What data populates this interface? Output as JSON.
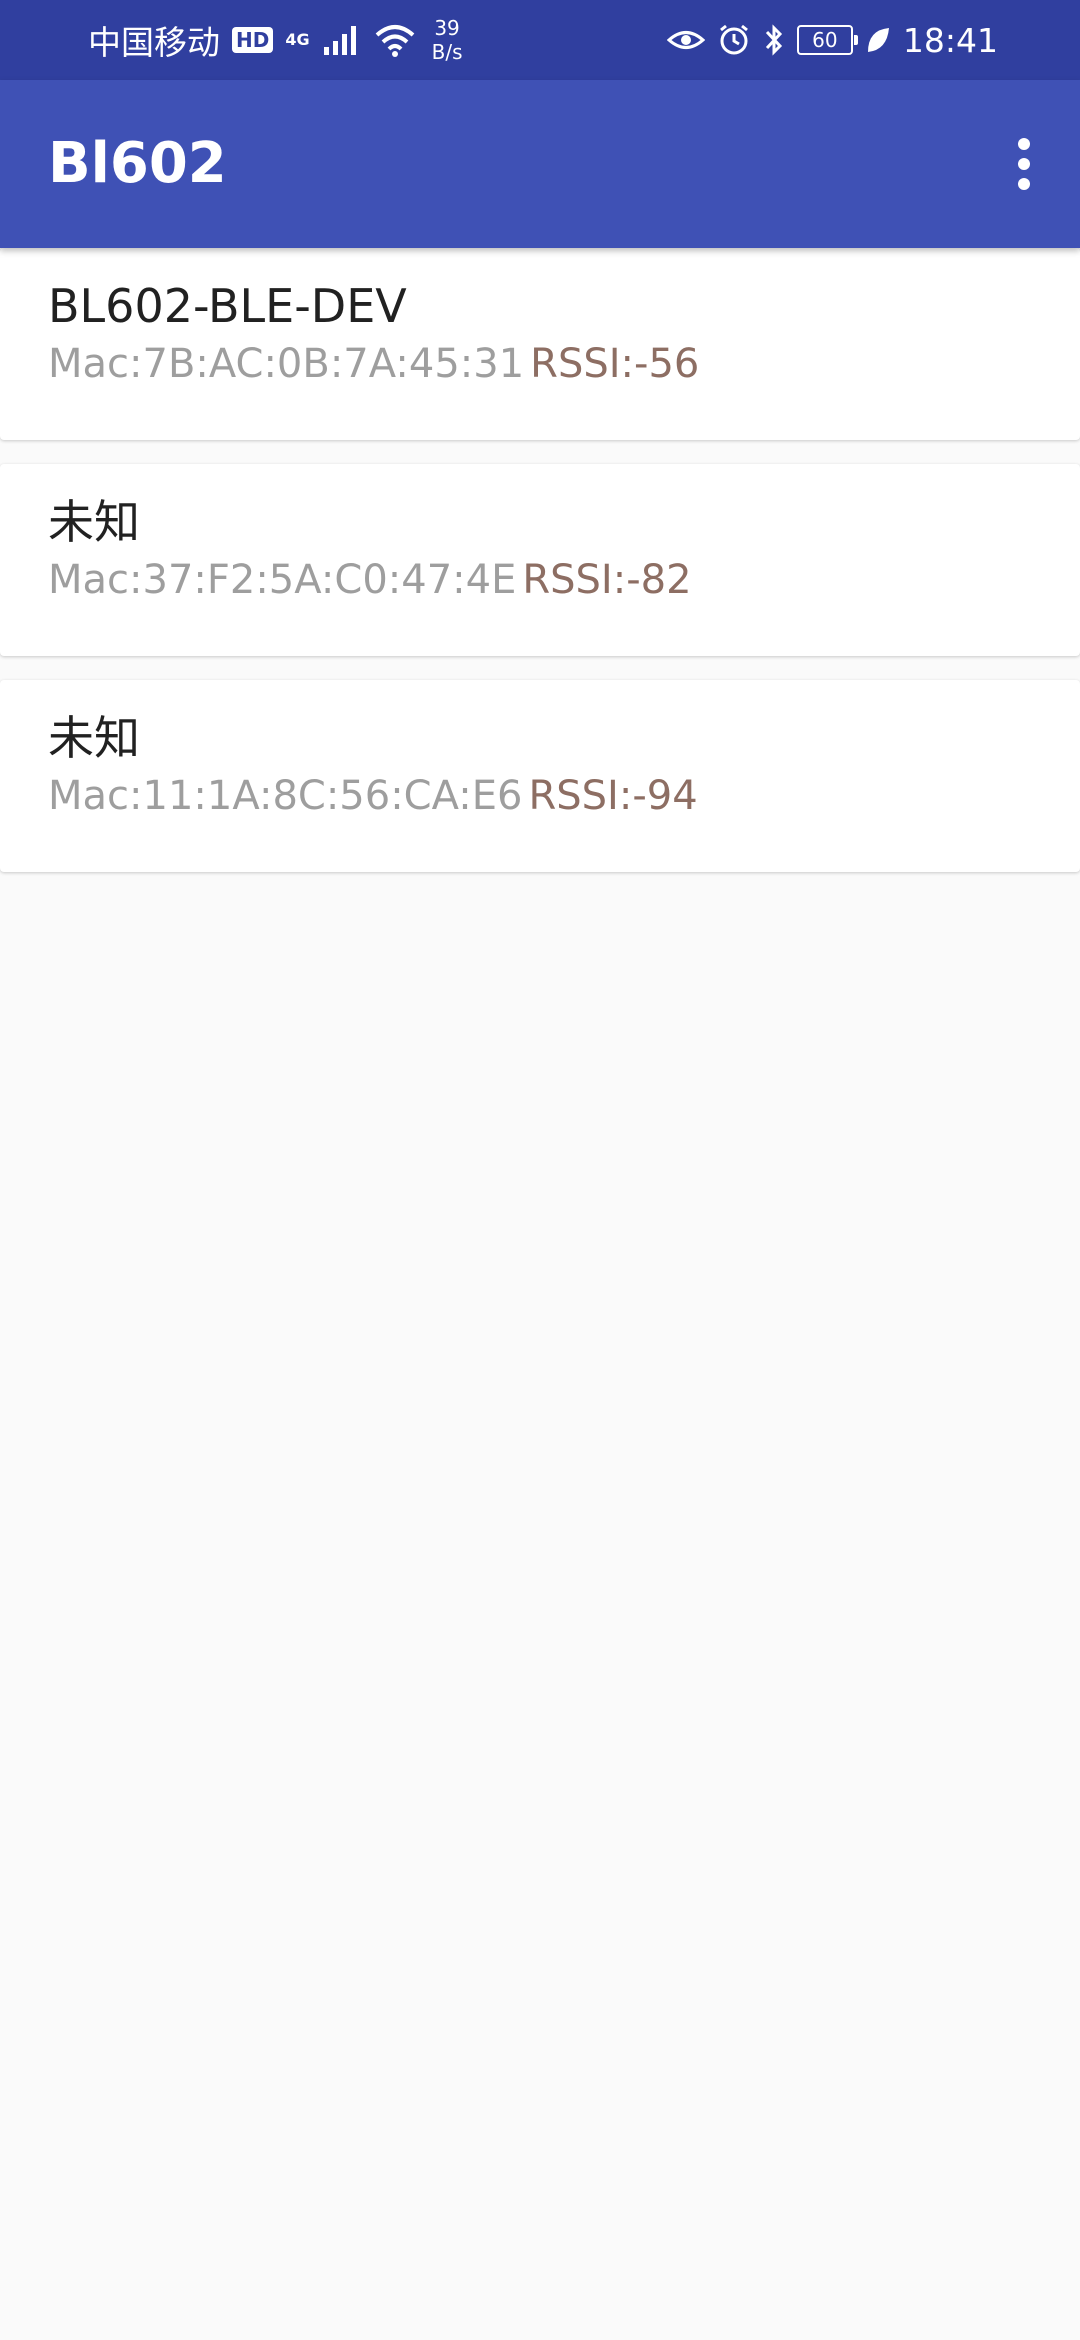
{
  "status_bar": {
    "carrier": "中国移动",
    "hd": "HD",
    "network_type": "4G",
    "speed_value": "39",
    "speed_unit": "B/s",
    "battery": "60",
    "time": "18:41",
    "icons": [
      "hd-icon",
      "signal-icon",
      "wifi-icon",
      "eye-icon",
      "alarm-icon",
      "bluetooth-icon",
      "battery-icon",
      "leaf-icon"
    ]
  },
  "app_bar": {
    "title": "Bl602",
    "menu_icon": "more-vert-icon",
    "background": "#3f51b5"
  },
  "devices": [
    {
      "name": "BL602-BLE-DEV",
      "mac": "Mac:7B:AC:0B:7A:45:31",
      "rssi": "RSSI:-56"
    },
    {
      "name": "未知",
      "mac": "Mac:37:F2:5A:C0:47:4E",
      "rssi": "RSSI:-82"
    },
    {
      "name": "未知",
      "mac": "Mac:11:1A:8C:56:CA:E6",
      "rssi": "RSSI:-94"
    }
  ],
  "colors": {
    "status_bar": "#303f9f",
    "app_bar": "#3f51b5",
    "mac_text": "#9e9e9e",
    "rssi_text": "#8d6e63",
    "background": "#fafafa"
  }
}
